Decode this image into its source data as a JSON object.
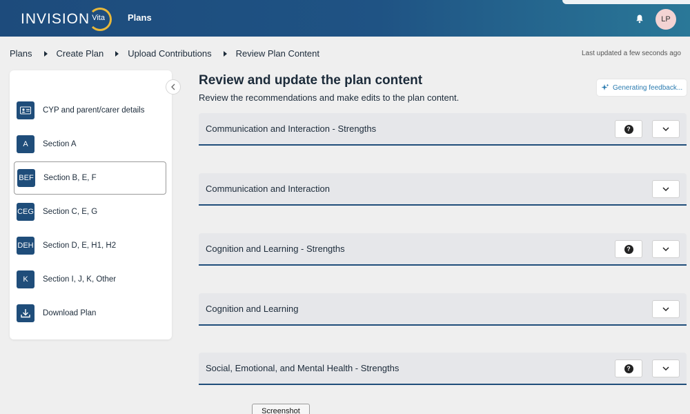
{
  "app": {
    "logo_text": "INVISION",
    "logo_sub": "Vita",
    "nav_label": "Plans",
    "user_initials": "LP"
  },
  "breadcrumb": [
    "Plans",
    "Create Plan",
    "Upload Contributions",
    "Review Plan Content"
  ],
  "last_updated": "Last updated a few seconds ago",
  "sidebar": {
    "items": [
      {
        "badge": "",
        "icon": "id-card-icon",
        "label": "CYP and parent/carer details"
      },
      {
        "badge": "A",
        "label": "Section A"
      },
      {
        "badge": "BEF",
        "label": "Section B, E, F",
        "active": true
      },
      {
        "badge": "CEG",
        "label": "Section C, E, G"
      },
      {
        "badge": "DEH",
        "label": "Section D, E, H1, H2"
      },
      {
        "badge": "K",
        "label": "Section I, J, K, Other"
      },
      {
        "badge": "",
        "icon": "download-icon",
        "label": "Download Plan"
      }
    ]
  },
  "main": {
    "title": "Review and update the plan content",
    "subtitle": "Review the recommendations and make edits to the plan content.",
    "feedback_label": "Generating feedback...",
    "sections": [
      {
        "label": "Communication and Interaction - Strengths",
        "has_help": true
      },
      {
        "label": "Communication and Interaction",
        "has_help": false
      },
      {
        "label": "Cognition and Learning - Strengths",
        "has_help": true
      },
      {
        "label": "Cognition and Learning",
        "has_help": false
      },
      {
        "label": "Social, Emotional, and Mental Health - Strengths",
        "has_help": true
      }
    ]
  },
  "screenshot_label": "Screenshot",
  "colors": {
    "brand": "#1f4d7a",
    "accent": "#e8b83a",
    "link": "#2a7bb0"
  }
}
